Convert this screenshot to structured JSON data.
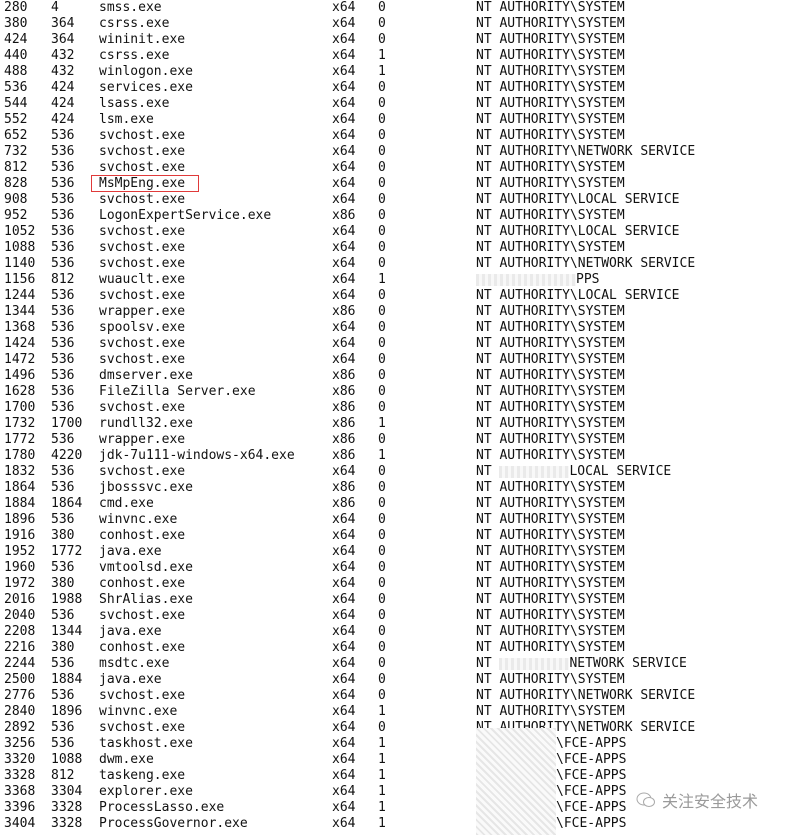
{
  "highlight_color": "#e03a3a",
  "highlighted_process": "MsMpEng.exe",
  "watermark": {
    "icon": "wechat-icon",
    "text": "关注安全技术"
  },
  "processes": [
    {
      "pid": "280",
      "ppid": "4",
      "name": "smss.exe",
      "arch": "x64",
      "session": "0",
      "user": "NT AUTHORITY\\SYSTEM"
    },
    {
      "pid": "380",
      "ppid": "364",
      "name": "csrss.exe",
      "arch": "x64",
      "session": "0",
      "user": "NT AUTHORITY\\SYSTEM"
    },
    {
      "pid": "424",
      "ppid": "364",
      "name": "wininit.exe",
      "arch": "x64",
      "session": "0",
      "user": "NT AUTHORITY\\SYSTEM"
    },
    {
      "pid": "440",
      "ppid": "432",
      "name": "csrss.exe",
      "arch": "x64",
      "session": "1",
      "user": "NT AUTHORITY\\SYSTEM"
    },
    {
      "pid": "488",
      "ppid": "432",
      "name": "winlogon.exe",
      "arch": "x64",
      "session": "1",
      "user": "NT AUTHORITY\\SYSTEM"
    },
    {
      "pid": "536",
      "ppid": "424",
      "name": "services.exe",
      "arch": "x64",
      "session": "0",
      "user": "NT AUTHORITY\\SYSTEM"
    },
    {
      "pid": "544",
      "ppid": "424",
      "name": "lsass.exe",
      "arch": "x64",
      "session": "0",
      "user": "NT AUTHORITY\\SYSTEM"
    },
    {
      "pid": "552",
      "ppid": "424",
      "name": "lsm.exe",
      "arch": "x64",
      "session": "0",
      "user": "NT AUTHORITY\\SYSTEM"
    },
    {
      "pid": "652",
      "ppid": "536",
      "name": "svchost.exe",
      "arch": "x64",
      "session": "0",
      "user": "NT AUTHORITY\\SYSTEM"
    },
    {
      "pid": "732",
      "ppid": "536",
      "name": "svchost.exe",
      "arch": "x64",
      "session": "0",
      "user": "NT AUTHORITY\\NETWORK SERVICE"
    },
    {
      "pid": "812",
      "ppid": "536",
      "name": "svchost.exe",
      "arch": "x64",
      "session": "0",
      "user": "NT AUTHORITY\\SYSTEM"
    },
    {
      "pid": "828",
      "ppid": "536",
      "name": "MsMpEng.exe",
      "arch": "x64",
      "session": "0",
      "user": "NT AUTHORITY\\SYSTEM"
    },
    {
      "pid": "908",
      "ppid": "536",
      "name": "svchost.exe",
      "arch": "x64",
      "session": "0",
      "user": "NT AUTHORITY\\LOCAL SERVICE"
    },
    {
      "pid": "952",
      "ppid": "536",
      "name": "LogonExpertService.exe",
      "arch": "x86",
      "session": "0",
      "user": "NT AUTHORITY\\SYSTEM"
    },
    {
      "pid": "1052",
      "ppid": "536",
      "name": "svchost.exe",
      "arch": "x64",
      "session": "0",
      "user": "NT AUTHORITY\\LOCAL SERVICE"
    },
    {
      "pid": "1088",
      "ppid": "536",
      "name": "svchost.exe",
      "arch": "x64",
      "session": "0",
      "user": "NT AUTHORITY\\SYSTEM"
    },
    {
      "pid": "1140",
      "ppid": "536",
      "name": "svchost.exe",
      "arch": "x64",
      "session": "0",
      "user": "NT AUTHORITY\\NETWORK SERVICE"
    },
    {
      "pid": "1156",
      "ppid": "812",
      "name": "wuauclt.exe",
      "arch": "x64",
      "session": "1",
      "user": "PPS",
      "redacted_prefix": true
    },
    {
      "pid": "1244",
      "ppid": "536",
      "name": "svchost.exe",
      "arch": "x64",
      "session": "0",
      "user": "NT AUTHORITY\\LOCAL SERVICE"
    },
    {
      "pid": "1344",
      "ppid": "536",
      "name": "wrapper.exe",
      "arch": "x86",
      "session": "0",
      "user": "NT AUTHORITY\\SYSTEM"
    },
    {
      "pid": "1368",
      "ppid": "536",
      "name": "spoolsv.exe",
      "arch": "x64",
      "session": "0",
      "user": "NT AUTHORITY\\SYSTEM"
    },
    {
      "pid": "1424",
      "ppid": "536",
      "name": "svchost.exe",
      "arch": "x64",
      "session": "0",
      "user": "NT AUTHORITY\\SYSTEM"
    },
    {
      "pid": "1472",
      "ppid": "536",
      "name": "svchost.exe",
      "arch": "x64",
      "session": "0",
      "user": "NT AUTHORITY\\SYSTEM"
    },
    {
      "pid": "1496",
      "ppid": "536",
      "name": "dmserver.exe",
      "arch": "x86",
      "session": "0",
      "user": "NT AUTHORITY\\SYSTEM"
    },
    {
      "pid": "1628",
      "ppid": "536",
      "name": "FileZilla Server.exe",
      "arch": "x86",
      "session": "0",
      "user": "NT AUTHORITY\\SYSTEM"
    },
    {
      "pid": "1700",
      "ppid": "536",
      "name": "svchost.exe",
      "arch": "x86",
      "session": "0",
      "user": "NT AUTHORITY\\SYSTEM"
    },
    {
      "pid": "1732",
      "ppid": "1700",
      "name": "rundll32.exe",
      "arch": "x86",
      "session": "1",
      "user": "NT AUTHORITY\\SYSTEM"
    },
    {
      "pid": "1772",
      "ppid": "536",
      "name": "wrapper.exe",
      "arch": "x86",
      "session": "0",
      "user": "NT AUTHORITY\\SYSTEM"
    },
    {
      "pid": "1780",
      "ppid": "4220",
      "name": "jdk-7u111-windows-x64.exe",
      "arch": "x86",
      "session": "1",
      "user": "NT AUTHORITY\\SYSTEM"
    },
    {
      "pid": "1832",
      "ppid": "536",
      "name": "svchost.exe",
      "arch": "x64",
      "session": "0",
      "user": "LOCAL SERVICE",
      "user_prefix": "NT ",
      "redacted_middle": true
    },
    {
      "pid": "1864",
      "ppid": "536",
      "name": "jbosssvc.exe",
      "arch": "x86",
      "session": "0",
      "user": "NT AUTHORITY\\SYSTEM"
    },
    {
      "pid": "1884",
      "ppid": "1864",
      "name": "cmd.exe",
      "arch": "x86",
      "session": "0",
      "user": "NT AUTHORITY\\SYSTEM"
    },
    {
      "pid": "1896",
      "ppid": "536",
      "name": "winvnc.exe",
      "arch": "x64",
      "session": "0",
      "user": "NT AUTHORITY\\SYSTEM"
    },
    {
      "pid": "1916",
      "ppid": "380",
      "name": "conhost.exe",
      "arch": "x64",
      "session": "0",
      "user": "NT AUTHORITY\\SYSTEM"
    },
    {
      "pid": "1952",
      "ppid": "1772",
      "name": "java.exe",
      "arch": "x64",
      "session": "0",
      "user": "NT AUTHORITY\\SYSTEM"
    },
    {
      "pid": "1960",
      "ppid": "536",
      "name": "vmtoolsd.exe",
      "arch": "x64",
      "session": "0",
      "user": "NT AUTHORITY\\SYSTEM"
    },
    {
      "pid": "1972",
      "ppid": "380",
      "name": "conhost.exe",
      "arch": "x64",
      "session": "0",
      "user": "NT AUTHORITY\\SYSTEM"
    },
    {
      "pid": "2016",
      "ppid": "1988",
      "name": "ShrAlias.exe",
      "arch": "x64",
      "session": "0",
      "user": "NT AUTHORITY\\SYSTEM"
    },
    {
      "pid": "2040",
      "ppid": "536",
      "name": "svchost.exe",
      "arch": "x64",
      "session": "0",
      "user": "NT AUTHORITY\\SYSTEM"
    },
    {
      "pid": "2208",
      "ppid": "1344",
      "name": "java.exe",
      "arch": "x64",
      "session": "0",
      "user": "NT AUTHORITY\\SYSTEM"
    },
    {
      "pid": "2216",
      "ppid": "380",
      "name": "conhost.exe",
      "arch": "x64",
      "session": "0",
      "user": "NT AUTHORITY\\SYSTEM"
    },
    {
      "pid": "2244",
      "ppid": "536",
      "name": "msdtc.exe",
      "arch": "x64",
      "session": "0",
      "user": "NETWORK SERVICE",
      "user_prefix": "NT ",
      "redacted_middle": true
    },
    {
      "pid": "2500",
      "ppid": "1884",
      "name": "java.exe",
      "arch": "x64",
      "session": "0",
      "user": "NT AUTHORITY\\SYSTEM"
    },
    {
      "pid": "2776",
      "ppid": "536",
      "name": "svchost.exe",
      "arch": "x64",
      "session": "0",
      "user": "NT AUTHORITY\\NETWORK SERVICE"
    },
    {
      "pid": "2840",
      "ppid": "1896",
      "name": "winvnc.exe",
      "arch": "x64",
      "session": "1",
      "user": "NT AUTHORITY\\SYSTEM"
    },
    {
      "pid": "2892",
      "ppid": "536",
      "name": "svchost.exe",
      "arch": "x64",
      "session": "0",
      "user": "NT AUTHORITY\\NETWORK SERVICE"
    },
    {
      "pid": "3256",
      "ppid": "536",
      "name": "taskhost.exe",
      "arch": "x64",
      "session": "1",
      "user": "\\FCE-APPS",
      "redacted_prefix": true
    },
    {
      "pid": "3320",
      "ppid": "1088",
      "name": "dwm.exe",
      "arch": "x64",
      "session": "1",
      "user": "\\FCE-APPS",
      "redacted_prefix": true
    },
    {
      "pid": "3328",
      "ppid": "812",
      "name": "taskeng.exe",
      "arch": "x64",
      "session": "1",
      "user": "\\FCE-APPS",
      "redacted_prefix": true
    },
    {
      "pid": "3368",
      "ppid": "3304",
      "name": "explorer.exe",
      "arch": "x64",
      "session": "1",
      "user": "\\FCE-APPS",
      "redacted_prefix": true
    },
    {
      "pid": "3396",
      "ppid": "3328",
      "name": "ProcessLasso.exe",
      "arch": "x64",
      "session": "1",
      "user": "\\FCE-APPS",
      "redacted_prefix": true
    },
    {
      "pid": "3404",
      "ppid": "3328",
      "name": "ProcessGovernor.exe",
      "arch": "x64",
      "session": "1",
      "user": "\\FCE-APPS",
      "redacted_prefix": true
    }
  ]
}
